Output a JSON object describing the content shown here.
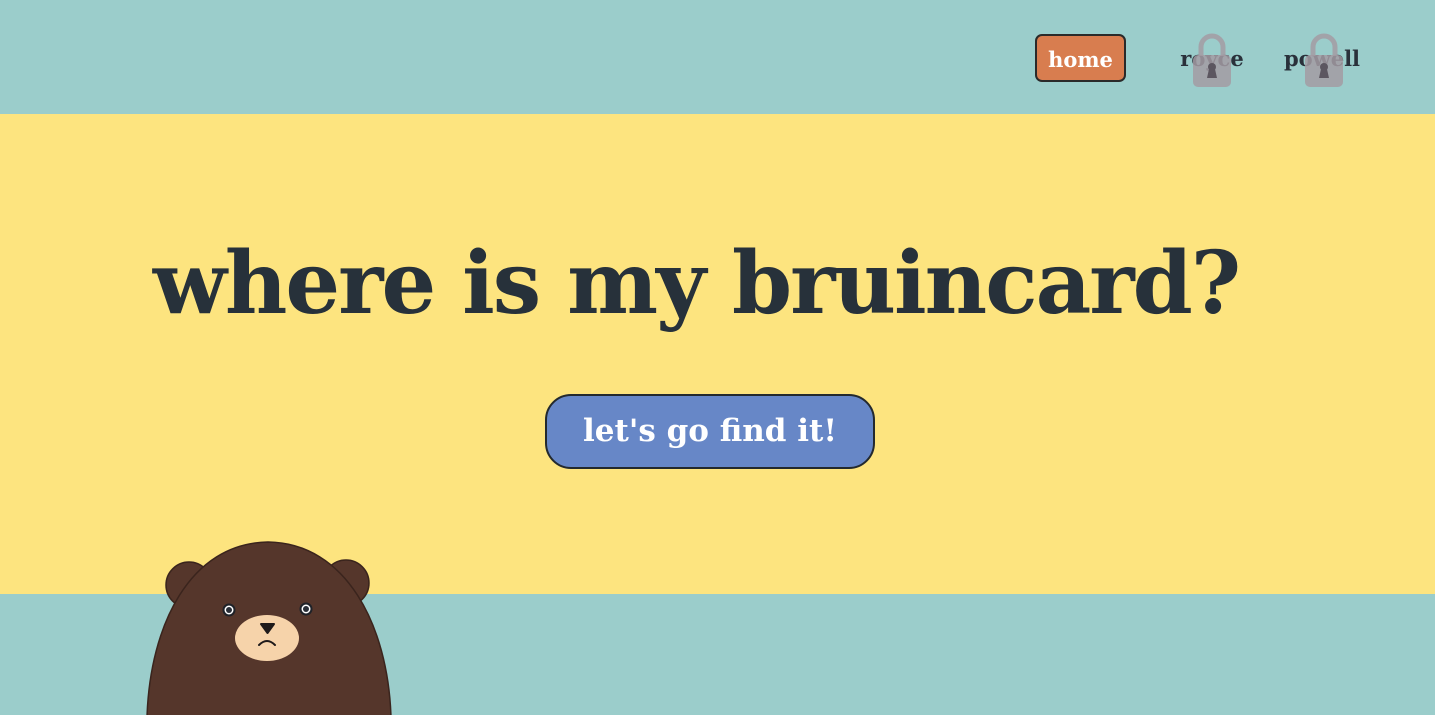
{
  "nav": {
    "home_label": "home",
    "royce_label": "royce",
    "powell_label": "powell",
    "royce_locked": true,
    "powell_locked": true
  },
  "hero": {
    "title": "where is my bruincard?",
    "cta_label": "let's go find it!"
  },
  "icons": {
    "lock": "lock-icon",
    "bear": "bear-illustration"
  },
  "colors": {
    "background": "#9bcdcb",
    "hero_background": "#fde47f",
    "home_button": "#d87d4f",
    "cta_button": "#6787c7",
    "text_dark": "#27313a",
    "bear_fur": "#55362b",
    "bear_muzzle": "#f6d3aa",
    "lock": "#a8a0a8"
  }
}
